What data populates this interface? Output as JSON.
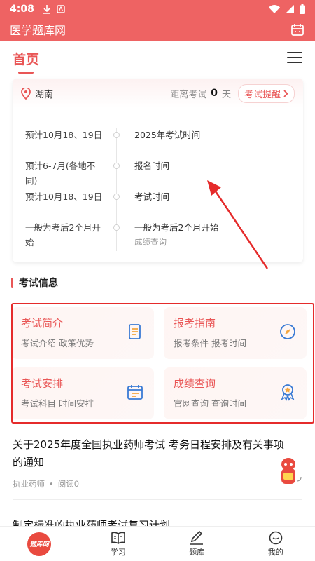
{
  "status_bar": {
    "time": "4:08"
  },
  "app_bar": {
    "title": "医学题库网"
  },
  "header": {
    "tab_home": "首页"
  },
  "exam_card": {
    "location": "湖南",
    "countdown_prefix": "距离考试",
    "countdown_value": "0",
    "countdown_unit": "天",
    "remind_label": "考试提醒",
    "timeline": [
      {
        "left": "预计10月18、19日",
        "right": "2025年考试时间",
        "sub": ""
      },
      {
        "left": "预计6-7月(各地不同)",
        "right": "报名时间",
        "sub": ""
      },
      {
        "left": "预计10月18、19日",
        "right": "考试时间",
        "sub": ""
      },
      {
        "left": "一般为考后2个月开始",
        "right": "一般为考后2个月开始",
        "sub": "成绩查询"
      }
    ]
  },
  "section": {
    "title": "考试信息"
  },
  "info_cards": [
    {
      "title": "考试简介",
      "sub": "考试介绍 政策优势",
      "icon": "document-icon"
    },
    {
      "title": "报考指南",
      "sub": "报考条件 报考时间",
      "icon": "compass-icon"
    },
    {
      "title": "考试安排",
      "sub": "考试科目 时间安排",
      "icon": "calendar-icon"
    },
    {
      "title": "成绩查询",
      "sub": "官网查询 查询时间",
      "icon": "award-icon"
    }
  ],
  "article": {
    "title": "关于2025年度全国执业药师考试 考务日程安排及有关事项的通知",
    "category": "执业药师",
    "reads": "阅读0"
  },
  "article2": {
    "title": "制定标准的执业药师考试复习计划"
  },
  "bottom_nav": {
    "logo_text": "题库网",
    "items": [
      "学习",
      "题库",
      "我的"
    ]
  },
  "colors": {
    "brand": "#ee6363",
    "accent": "#e95656",
    "highlight": "#e52b2b"
  }
}
